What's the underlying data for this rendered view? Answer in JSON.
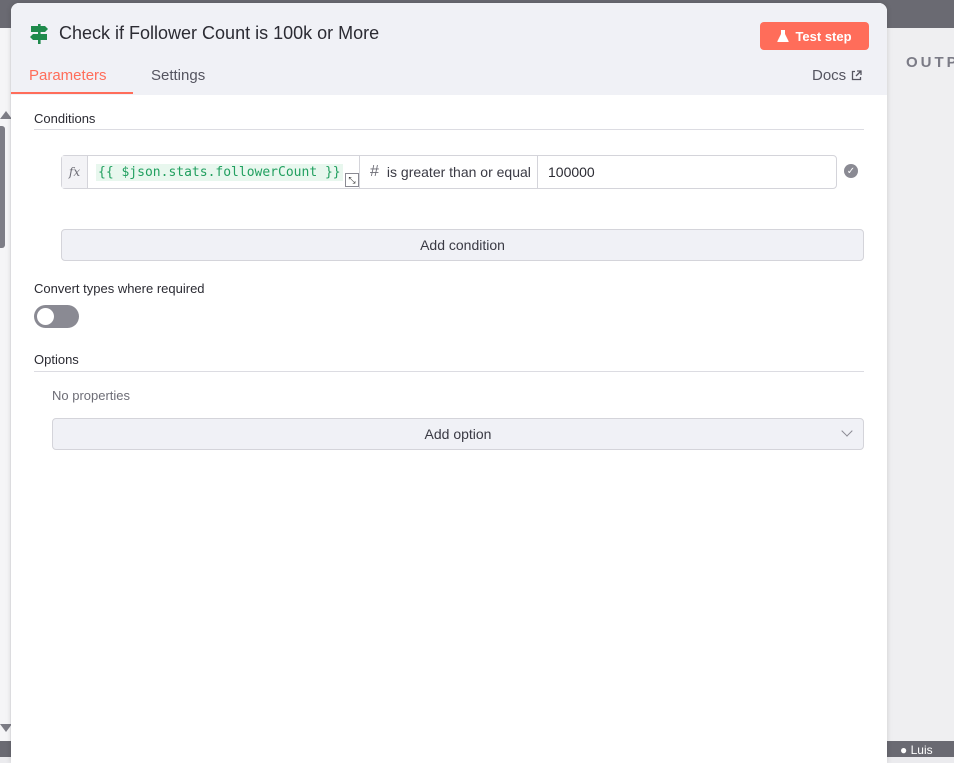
{
  "header": {
    "title": "Check if Follower Count is 100k or More",
    "test_button": "Test step"
  },
  "tabs": [
    {
      "label": "Parameters",
      "active": true
    },
    {
      "label": "Settings",
      "active": false
    }
  ],
  "docs_label": "Docs",
  "conditions": {
    "section_label": "Conditions",
    "fx_label": "fx",
    "left_value": "{{ $json.stats.followerCount }}",
    "type_icon": "#",
    "operator": "is greater than or equal",
    "right_value": "100000",
    "add_button": "Add condition"
  },
  "convert_types": {
    "label": "Convert types where required",
    "enabled": false
  },
  "options": {
    "section_label": "Options",
    "empty_text": "No properties",
    "add_button": "Add option"
  },
  "side_panel": {
    "output_label": "OUTP",
    "user_label": "Luis"
  },
  "colors": {
    "accent": "#ff6d5a",
    "expression_green": "#22a060",
    "node_icon_green": "#1f8a4c"
  },
  "icons": [
    "signpost-icon",
    "flask-icon",
    "external-link-icon",
    "expand-icon",
    "hash-icon",
    "check-circle-icon",
    "chevron-down-icon"
  ]
}
